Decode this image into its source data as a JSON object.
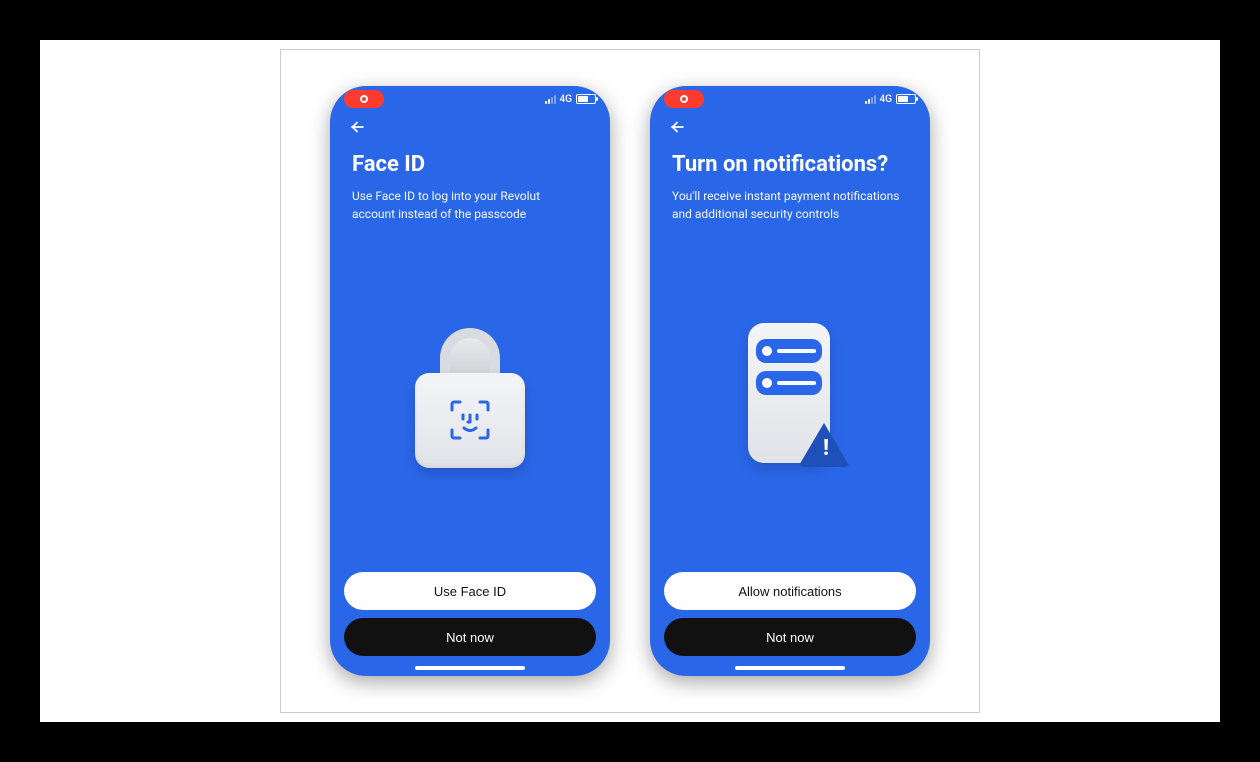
{
  "status": {
    "network": "4G"
  },
  "screens": [
    {
      "title": "Face ID",
      "subtitle": "Use Face ID to log into your Revolut account instead of the passcode",
      "primary_label": "Use Face ID",
      "secondary_label": "Not now"
    },
    {
      "title": "Turn on notifications?",
      "subtitle": "You'll receive instant payment notifications and additional security controls",
      "primary_label": "Allow notifications",
      "secondary_label": "Not now"
    }
  ]
}
